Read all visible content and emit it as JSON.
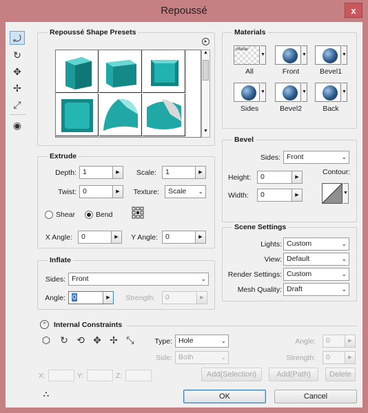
{
  "window": {
    "title": "Repoussé",
    "close_glyph": "x"
  },
  "presets": {
    "title": "Repoussé Shape Presets",
    "menu_glyph": "▸"
  },
  "materials": {
    "title": "Materials",
    "items": [
      {
        "label": "All",
        "swatch_text": "mfetan"
      },
      {
        "label": "Front"
      },
      {
        "label": "Bevel1"
      },
      {
        "label": "Sides"
      },
      {
        "label": "Bevel2"
      },
      {
        "label": "Back"
      }
    ]
  },
  "extrude": {
    "title": "Extrude",
    "depth_label": "Depth:",
    "depth": "1",
    "scale_label": "Scale:",
    "scale": "1",
    "twist_label": "Twist:",
    "twist": "0",
    "texture_label": "Texture:",
    "texture": "Scale",
    "shear_label": "Shear",
    "bend_label": "Bend",
    "selected_mode": "Bend",
    "xangle_label": "X Angle:",
    "xangle": "0",
    "yangle_label": "Y Angle:",
    "yangle": "0"
  },
  "inflate": {
    "title": "Inflate",
    "sides_label": "Sides:",
    "sides": "Front",
    "angle_label": "Angle:",
    "angle": "0",
    "strength_label": "Strength:",
    "strength": "0"
  },
  "bevel": {
    "title": "Bevel",
    "sides_label": "Sides:",
    "sides": "Front",
    "height_label": "Height:",
    "height": "0",
    "width_label": "Width:",
    "width": "0",
    "contour_label": "Contour:"
  },
  "scene": {
    "title": "Scene Settings",
    "lights_label": "Lights:",
    "lights": "Custom",
    "view_label": "View:",
    "view": "Default",
    "render_label": "Render Settings:",
    "render": "Custom",
    "mesh_label": "Mesh Quality:",
    "mesh": "Draft"
  },
  "constraints": {
    "title": "Internal Constraints",
    "type_label": "Type:",
    "type": "Hole",
    "side_label": "Side:",
    "side": "Both",
    "angle_label": "Angle:",
    "angle": "0",
    "strength_label": "Strength:",
    "strength": "0",
    "x_label": "X:",
    "y_label": "Y:",
    "z_label": "Z:",
    "add_selection": "Add(Selection)",
    "add_path": "Add(Path)",
    "delete": "Delete"
  },
  "buttons": {
    "ok": "OK",
    "cancel": "Cancel"
  },
  "colors": {
    "title_bar": "#c67f82",
    "dialog_bg": "#f0f0f0",
    "teal": "#1fa8a6",
    "sphere": "#2c5a88"
  }
}
